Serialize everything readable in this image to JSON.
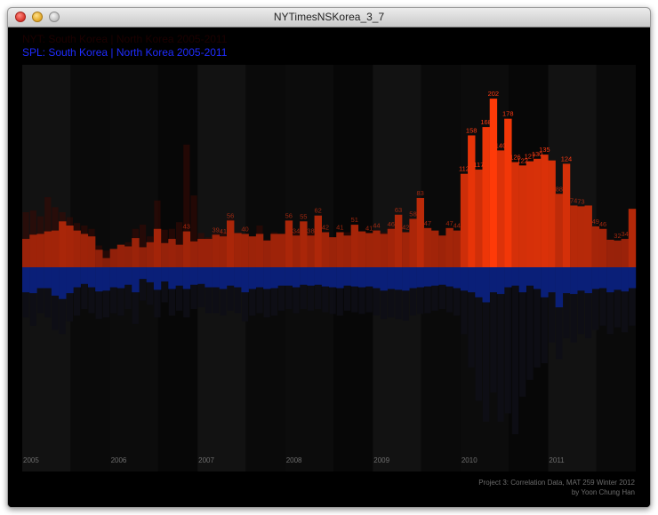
{
  "window": {
    "title": "NYTimesNSKorea_3_7"
  },
  "legend_faint": "NYT: South Korea | North Korea 2005-2011",
  "chart_data": {
    "type": "bar",
    "title": "SPL: South Korea | North Korea 2005-2011",
    "years": [
      "2005",
      "2006",
      "2007",
      "2008",
      "2009",
      "2010",
      "2011"
    ],
    "months_per_year": 12,
    "series": [
      {
        "name": "South Korea",
        "direction": "up",
        "values": [
          34,
          39,
          40,
          43,
          44,
          55,
          50,
          44,
          40,
          37,
          21,
          11,
          22,
          27,
          25,
          35,
          24,
          30,
          46,
          29,
          34,
          27,
          43,
          31,
          34,
          34,
          39,
          37,
          56,
          41,
          40,
          37,
          40,
          32,
          40,
          40,
          56,
          38,
          55,
          38,
          62,
          42,
          36,
          42,
          38,
          51,
          43,
          41,
          44,
          40,
          46,
          63,
          42,
          58,
          83,
          47,
          44,
          38,
          47,
          44,
          112,
          158,
          117,
          168,
          202,
          140,
          178,
          126,
          122,
          127,
          130,
          135,
          128,
          88,
          124,
          74,
          73,
          74,
          49,
          46,
          33,
          32,
          34,
          70
        ],
        "labels": [
          null,
          null,
          null,
          null,
          null,
          null,
          null,
          null,
          null,
          null,
          null,
          null,
          null,
          null,
          null,
          null,
          null,
          null,
          null,
          null,
          null,
          null,
          "43",
          null,
          null,
          null,
          "39",
          "41",
          "56",
          null,
          "40",
          null,
          null,
          null,
          null,
          null,
          "56",
          "34",
          "55",
          "38",
          "62",
          "42",
          null,
          "41",
          null,
          "51",
          null,
          "41",
          "44",
          null,
          "46",
          "63",
          "42",
          "58",
          "83",
          "47",
          null,
          null,
          "47",
          "44",
          "112",
          "158",
          "117",
          "168",
          "202",
          "140",
          "178",
          "126",
          "122",
          "127",
          "130",
          "135",
          null,
          "88",
          "124",
          "74",
          "73",
          null,
          "49",
          "46",
          null,
          "32",
          "34",
          null
        ],
        "faint_values": [
          66,
          68,
          61,
          84,
          72,
          66,
          60,
          53,
          50,
          46,
          26,
          20,
          20,
          24,
          30,
          46,
          51,
          37,
          80,
          45,
          46,
          54,
          147,
          86,
          41,
          36,
          41,
          42,
          58,
          40,
          35,
          37,
          50,
          33,
          42,
          40,
          50,
          42,
          48,
          41,
          54,
          39,
          35,
          38,
          42,
          49,
          40,
          41,
          45,
          42,
          48,
          50,
          40,
          48,
          62,
          45,
          40,
          38,
          42,
          44,
          80,
          95,
          70,
          100,
          120,
          90,
          105,
          82,
          78,
          80,
          82,
          85,
          74,
          60,
          80,
          56,
          56,
          55,
          42,
          40,
          31,
          30,
          32,
          70
        ]
      },
      {
        "name": "North Korea",
        "direction": "down",
        "values": [
          30,
          31,
          25,
          25,
          34,
          38,
          31,
          24,
          20,
          24,
          29,
          28,
          24,
          25,
          21,
          30,
          14,
          18,
          27,
          17,
          26,
          22,
          26,
          21,
          20,
          24,
          24,
          26,
          22,
          24,
          30,
          26,
          24,
          26,
          25,
          22,
          22,
          24,
          21,
          22,
          21,
          23,
          24,
          25,
          22,
          23,
          24,
          23,
          25,
          28,
          26,
          27,
          28,
          25,
          24,
          23,
          22,
          21,
          23,
          25,
          28,
          30,
          36,
          42,
          30,
          32,
          24,
          22,
          30,
          22,
          26,
          36,
          30,
          48,
          31,
          32,
          28,
          31,
          26,
          25,
          30,
          27,
          29,
          25
        ],
        "faint_values": [
          60,
          70,
          55,
          60,
          75,
          80,
          65,
          58,
          50,
          55,
          62,
          60,
          55,
          58,
          50,
          68,
          40,
          45,
          60,
          42,
          58,
          52,
          60,
          50,
          48,
          55,
          55,
          58,
          52,
          55,
          65,
          58,
          55,
          60,
          58,
          52,
          50,
          55,
          50,
          52,
          50,
          54,
          56,
          58,
          52,
          54,
          56,
          54,
          58,
          62,
          60,
          62,
          64,
          58,
          56,
          55,
          52,
          50,
          54,
          58,
          80,
          120,
          160,
          185,
          150,
          185,
          175,
          200,
          155,
          135,
          120,
          115,
          90,
          110,
          85,
          90,
          80,
          85,
          75,
          70,
          80,
          72,
          78,
          70
        ]
      }
    ],
    "colors": {
      "up_low": "#7a1b0a",
      "up_high": "#ff3a08",
      "down": "#0a1f78",
      "label": "#ff3a12"
    },
    "credits": [
      "Project 3: Correlation Data, MAT 259 Winter 2012",
      "by Yoon Chung Han"
    ]
  }
}
